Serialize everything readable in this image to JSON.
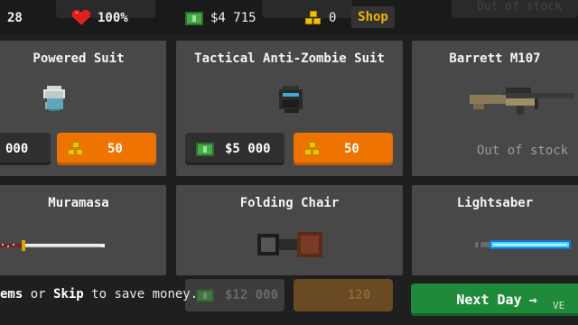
{
  "status": {
    "day_count": "28",
    "health": "100%",
    "money": "$4 715",
    "gold": "0",
    "shop_label": "Shop",
    "ghost_out_of_stock": "Out of stock",
    "ghost_label": "out of stock"
  },
  "items": [
    {
      "name": "Powered Suit",
      "cash_price": "000",
      "gold_price": "50"
    },
    {
      "name": "Tactical Anti-Zombie Suit",
      "cash_price": "$5 000",
      "gold_price": "50"
    },
    {
      "name": "Barrett M107",
      "stock_text": "Out of stock"
    },
    {
      "name": "Muramasa"
    },
    {
      "name": "Folding Chair",
      "cash_price": "$12 000",
      "gold_price": "120"
    },
    {
      "name": "Lightsaber"
    }
  ],
  "bottom": {
    "hint_part1": "ems",
    "hint_part2": " or ",
    "hint_part3": "Skip",
    "hint_part4": " to save money.",
    "next_label": "Next Day",
    "next_arrow": "→",
    "version": "VE"
  },
  "colors": {
    "accent_orange": "#ee7300",
    "next_green": "#1f8a3a",
    "shop_gold": "#f0b400"
  }
}
